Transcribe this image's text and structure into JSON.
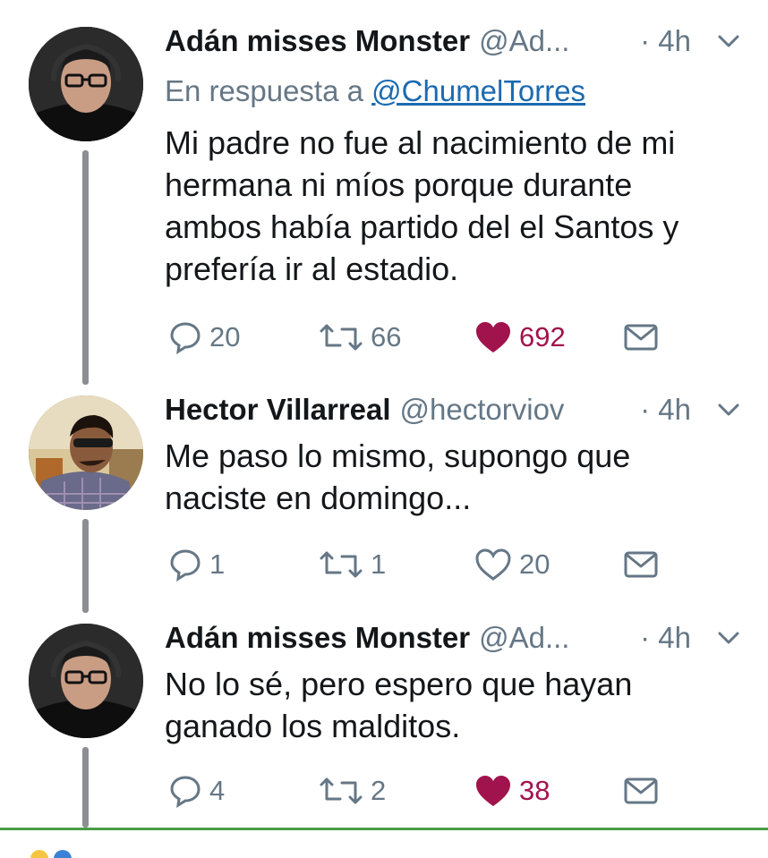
{
  "tweets": [
    {
      "name": "Adán misses Monster",
      "handle": "@Ad...",
      "time": "· 4h",
      "reply_prefix": "En respuesta a",
      "reply_mention": "@ChumelTorres",
      "lines": [
        "Mi padre no fue al nacimiento de mi",
        "hermana ni míos porque durante",
        "ambos había partido del el Santos y",
        "prefería ir al estadio."
      ],
      "replies": "20",
      "retweets": "66",
      "likes": "692",
      "liked": true
    },
    {
      "name": "Hector Villarreal",
      "handle": "@hectorviov",
      "time": "· 4h",
      "lines": [
        "Me paso lo mismo, supongo que",
        "naciste en domingo..."
      ],
      "replies": "1",
      "retweets": "1",
      "likes": "20",
      "liked": false
    },
    {
      "name": "Adán misses Monster",
      "handle": "@Ad...",
      "time": "· 4h",
      "lines": [
        "No lo sé, pero espero que hayan",
        "ganado los malditos."
      ],
      "replies": "4",
      "retweets": "2",
      "likes": "38",
      "liked": true
    }
  ],
  "colors": {
    "like_active": "#a1134c",
    "muted": "#657786",
    "mention": "#1b6ab0",
    "thread_line": "#8b8f94"
  },
  "icons": {
    "reply": "reply-bubble-icon",
    "retweet": "retweet-icon",
    "like": "heart-icon",
    "dm": "envelope-icon",
    "menu": "chevron-down-icon"
  }
}
